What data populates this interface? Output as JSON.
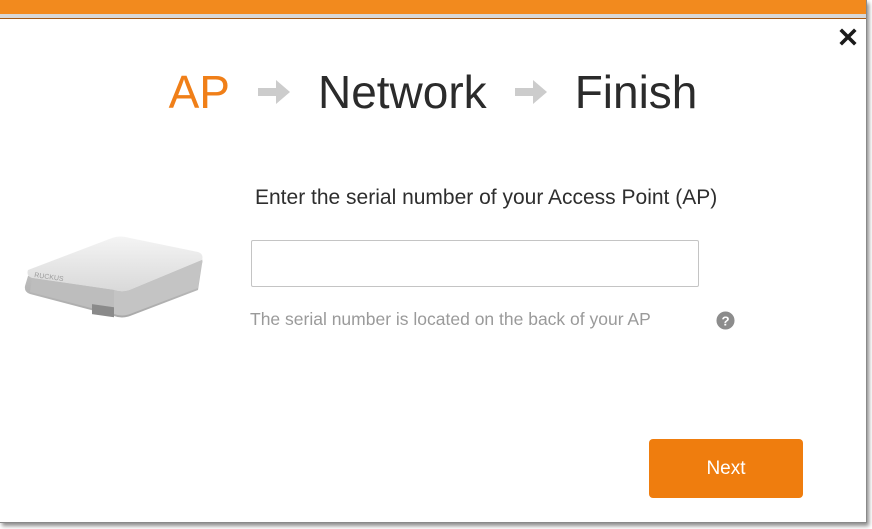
{
  "colors": {
    "accent": "#ef7d0e",
    "top_bar": "#f28a1e",
    "step_active": "#f07f18",
    "step_inactive": "#2b2b2b",
    "arrow": "#cccccc",
    "hint_text": "#9a9a9a"
  },
  "steps": [
    {
      "label": "AP",
      "active": true
    },
    {
      "label": "Network",
      "active": false
    },
    {
      "label": "Finish",
      "active": false
    }
  ],
  "icons": {
    "close": "close-icon",
    "arrow": "arrow-right-icon",
    "help": "question-circle-icon",
    "device": "access-point-image"
  },
  "form": {
    "instruction": "Enter the serial number of your Access Point (AP)",
    "serial_value": "",
    "serial_placeholder": "",
    "hint": "The serial number is located on the back of your AP"
  },
  "actions": {
    "next_label": "Next"
  }
}
